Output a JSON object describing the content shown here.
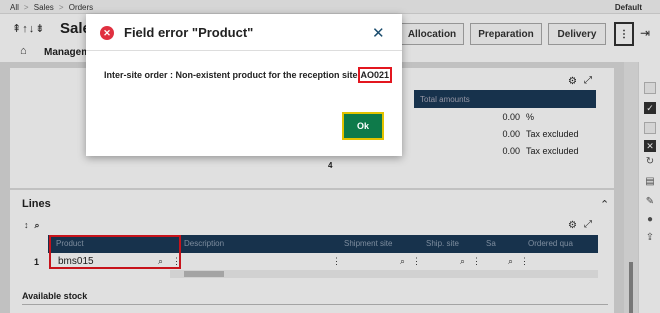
{
  "breadcrumb": [
    "All",
    "Sales",
    "Orders"
  ],
  "default_label": "Default",
  "header": {
    "title": "Sale",
    "actions": [
      "Allocation",
      "Preparation",
      "Delivery"
    ],
    "more_glyph": "⋮"
  },
  "tabs": {
    "active": "Management"
  },
  "values_table": {
    "column_header": "Total amounts",
    "rows": [
      {
        "value": "0.00",
        "unit": "%"
      },
      {
        "value": "0.00",
        "unit": "Tax excluded"
      },
      {
        "value": "0.00",
        "unit": "Tax excluded"
      }
    ],
    "footer_count": "4"
  },
  "lines": {
    "title": "Lines",
    "columns": [
      "Product",
      "Description",
      "Shipment site",
      "Ship. site",
      "Sa",
      "Ordered qua"
    ],
    "rows": [
      {
        "index": "1",
        "product": "bms015"
      }
    ],
    "available_stock_label": "Available stock"
  },
  "dialog": {
    "title": "Field error \"Product\"",
    "message": "Inter-site order : Non-existent product for the reception site",
    "code": "AO021",
    "ok_label": "Ok"
  },
  "icons": {
    "error": "error-icon",
    "close": "close-icon",
    "search": "search-icon",
    "more": "more-icon",
    "settings": "settings-icon",
    "expand": "expand-icon",
    "home": "home-icon",
    "exit": "exit-icon"
  },
  "colors": {
    "table_header": "#1b3a57",
    "ok_button": "#0e7a4a",
    "error_icon": "#e03040",
    "highlight": "#e3161f"
  }
}
